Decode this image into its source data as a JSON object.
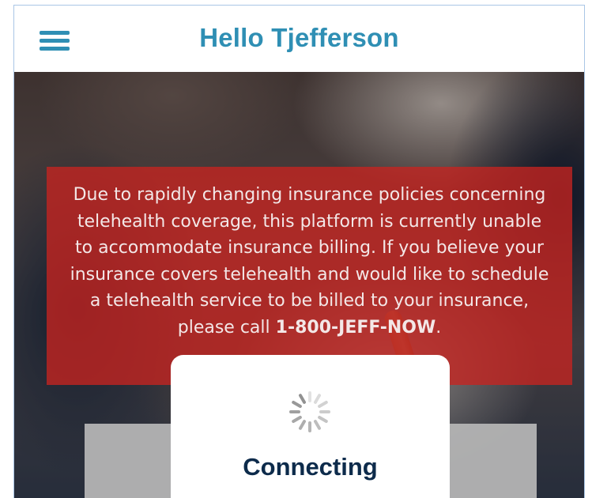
{
  "header": {
    "title": "Hello Tjefferson",
    "menu_icon": "hamburger-menu-icon"
  },
  "notice": {
    "text_before_phone": "Due to rapidly changing insurance policies concerning telehealth coverage, this platform is currently unable to accommodate insurance billing. If you believe your insurance covers telehealth and would like to schedule a telehealth service to be billed to your insurance, please call ",
    "phone": "1-800-JEFF-NOW",
    "text_after_phone": "."
  },
  "loader": {
    "label": "Connecting",
    "icon": "loading-spinner-icon"
  },
  "colors": {
    "accent": "#2f8fb4",
    "notice_bg": "#c62420",
    "loader_text": "#0d2b4b"
  }
}
